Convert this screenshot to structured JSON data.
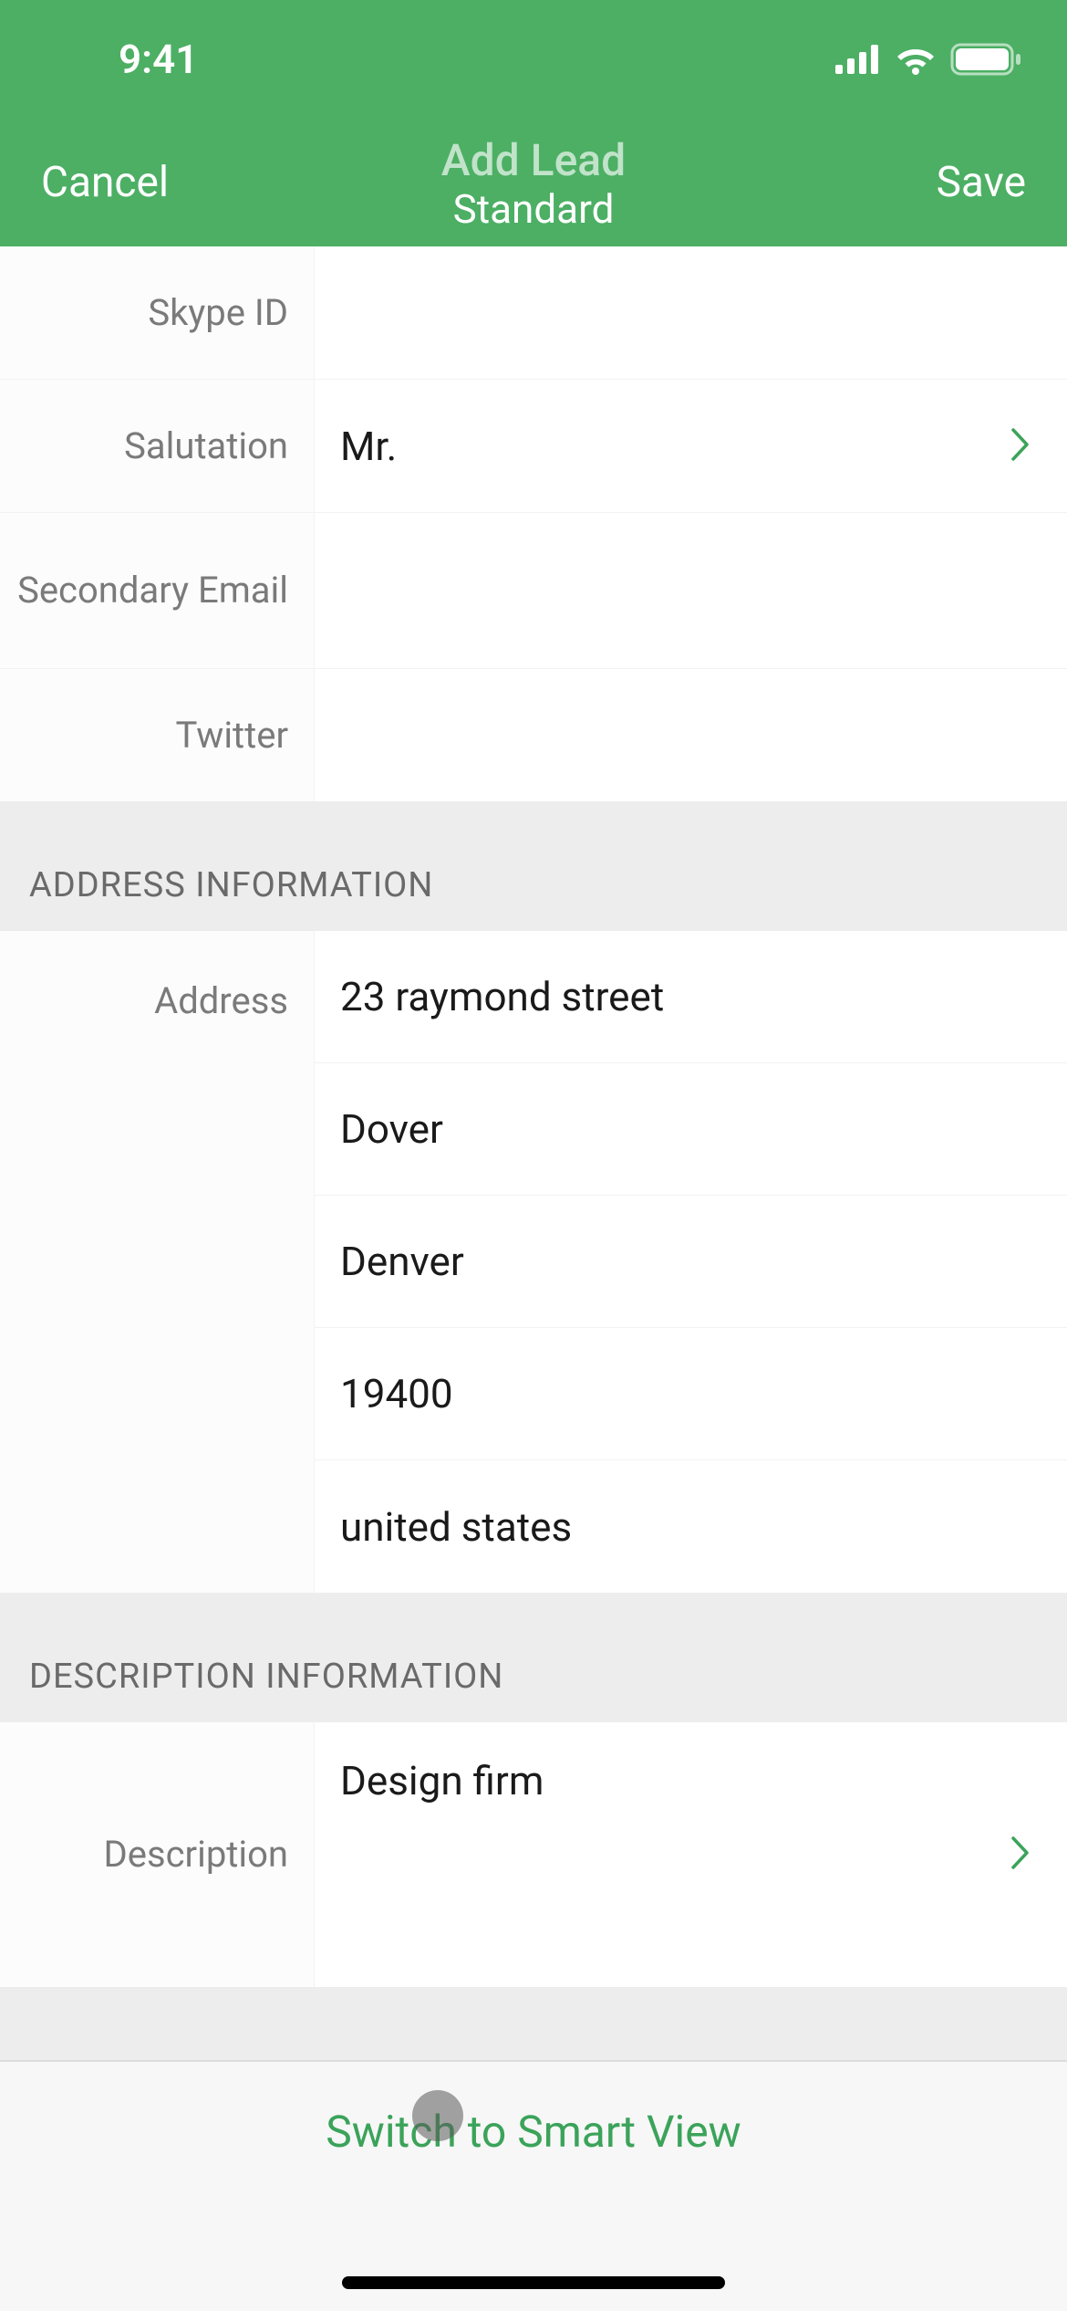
{
  "status": {
    "time": "9:41"
  },
  "nav": {
    "cancel_label": "Cancel",
    "title": "Add Lead",
    "subtitle": "Standard",
    "save_label": "Save"
  },
  "fields": {
    "skype": {
      "label": "Skype ID",
      "value": ""
    },
    "salutation": {
      "label": "Salutation",
      "value": "Mr."
    },
    "secondary_email": {
      "label": "Secondary Email",
      "value": ""
    },
    "twitter": {
      "label": "Twitter",
      "value": ""
    }
  },
  "sections": {
    "address_header": "ADDRESS INFORMATION",
    "description_header": "DESCRIPTION INFORMATION"
  },
  "address": {
    "label": "Address",
    "street": "23 raymond street",
    "city": "Dover",
    "state": "Denver",
    "zip": "19400",
    "country": "united states"
  },
  "description": {
    "label": "Description",
    "value": "Design firm"
  },
  "bottom": {
    "switch_label": "Switch to Smart View"
  },
  "colors": {
    "accent": "#4caf64",
    "link": "#3ba35a"
  }
}
